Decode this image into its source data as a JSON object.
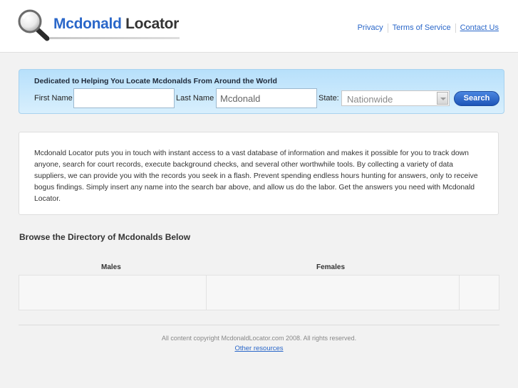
{
  "header": {
    "logo_brand": "Mcdonald",
    "logo_rest": " Locator",
    "links": {
      "privacy": "Privacy",
      "terms": "Terms of Service",
      "contact": "Contact Us"
    }
  },
  "search": {
    "title": "Dedicated to Helping You Locate Mcdonalds From Around the World",
    "first_name_label": "First Name",
    "first_name_value": "",
    "last_name_label": "Last Name",
    "last_name_value": "Mcdonald",
    "state_label": "State:",
    "state_value": "Nationwide",
    "button_label": "Search"
  },
  "description": "Mcdonald Locator puts you in touch with instant access to a vast database of information and makes it possible for you to track down anyone, search for court records, execute background checks, and several other worthwhile tools. By collecting a variety of data suppliers, we can provide you with the records you seek in a flash. Prevent spending endless hours hunting for answers, only to receive bogus findings. Simply insert any name into the search bar above, and allow us do the labor. Get the answers you need with Mcdonald Locator.",
  "directory": {
    "title": "Browse the Directory of Mcdonalds Below",
    "males_label": "Males",
    "females_label": "Females"
  },
  "footer": {
    "copyright": "All content copyright McdonaldLocator.com 2008. All rights reserved.",
    "other_resources": "Other resources"
  },
  "colors": {
    "brand_blue": "#2a67c9",
    "panel_blue": "#c6e7fc",
    "button_blue": "#2a62c4"
  }
}
